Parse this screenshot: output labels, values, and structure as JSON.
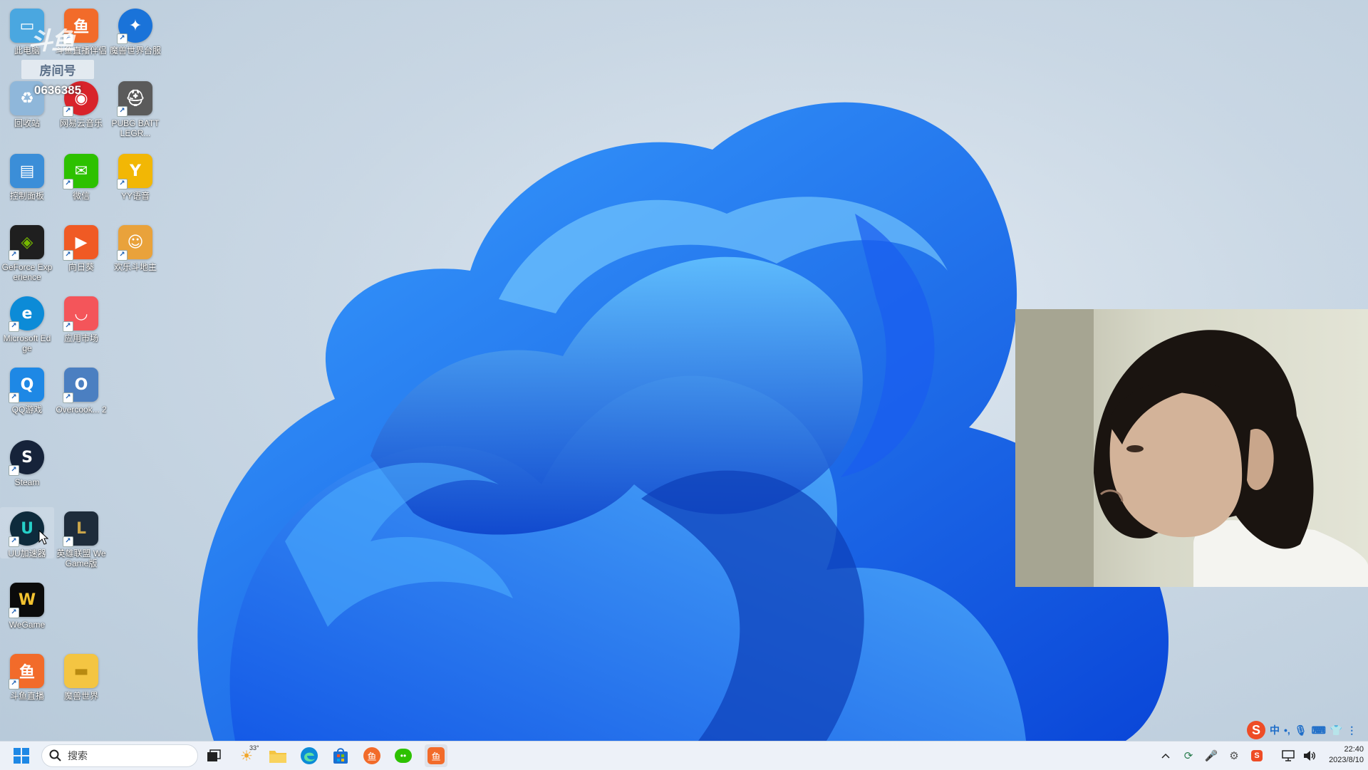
{
  "desktop": {
    "icons": [
      {
        "label": "此电脑",
        "color": "#4aa7e0",
        "glyph": "▭"
      },
      {
        "label": "斗鱼直播伴侣",
        "color": "#f26b2a",
        "glyph": "鱼"
      },
      {
        "label": "魔兽世界台服",
        "color": "#1a73d9",
        "glyph": "✦"
      },
      {
        "label": "回收站",
        "color": "#8fb7da",
        "glyph": "♻"
      },
      {
        "label": "网易云音乐",
        "color": "#d8232a",
        "glyph": "◉"
      },
      {
        "label": "PUBG BATTLEGR...",
        "color": "#5b5b5b",
        "glyph": "⛑"
      },
      {
        "label": "控制面板",
        "color": "#3b8ed8",
        "glyph": "▤"
      },
      {
        "label": "微信",
        "color": "#2dc100",
        "glyph": "✉"
      },
      {
        "label": "YY语音",
        "color": "#f2b705",
        "glyph": "Y"
      },
      {
        "label": "GeForce Experience",
        "color": "#1f1f1f",
        "glyph": "◈"
      },
      {
        "label": "向日葵",
        "color": "#f05a24",
        "glyph": "▶"
      },
      {
        "label": "欢乐斗地主",
        "color": "#e9a23b",
        "glyph": "☺"
      },
      {
        "label": "Microsoft Edge",
        "color": "#0c8bd7",
        "glyph": "e"
      },
      {
        "label": "应用市场",
        "color": "#f4555a",
        "glyph": "◡"
      },
      {
        "label": "QQ游戏",
        "color": "#1e88e5",
        "glyph": "Q"
      },
      {
        "label": "Overcook... 2",
        "color": "#4b7fc1",
        "glyph": "O"
      },
      {
        "label": "Steam",
        "color": "#16233a",
        "glyph": "S"
      },
      {
        "label": "UU加速器",
        "color": "#0e2b3c",
        "glyph": "U"
      },
      {
        "label": "英雄联盟 WeGame版",
        "color": "#1e2c3b",
        "glyph": "L"
      },
      {
        "label": "WeGame",
        "color": "#0b0b0b",
        "glyph": "W"
      },
      {
        "label": "斗鱼直播",
        "color": "#f26b2a",
        "glyph": "鱼"
      },
      {
        "label": "魔兽世界",
        "color": "#f4c542",
        "glyph": "▬"
      }
    ]
  },
  "overlay": {
    "room_label": "房间号",
    "room_number": "0636385"
  },
  "ime": {
    "lang": "中",
    "punct": "•,",
    "logo": "S"
  },
  "taskbar": {
    "search_placeholder": "搜索",
    "weather_temp": "33°",
    "time": "22:40",
    "date": "2023/8/10"
  },
  "colors": {
    "accent": "#1a73e8",
    "taskbar_bg": "#eef3f9"
  }
}
